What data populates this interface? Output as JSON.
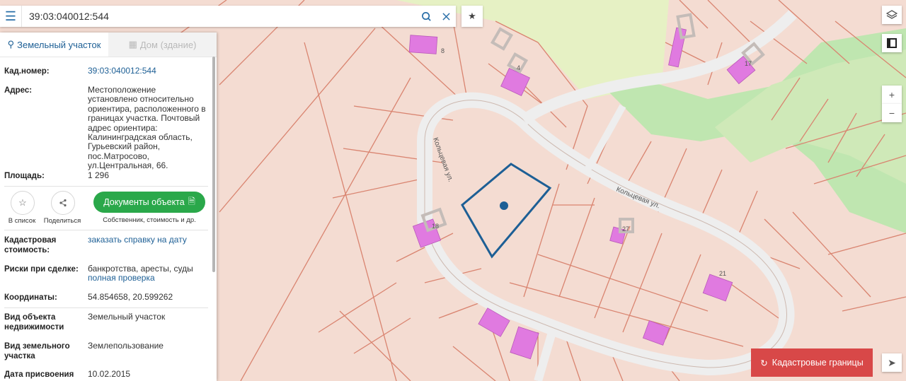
{
  "search": {
    "value": "39:03:040012:544"
  },
  "tabs": [
    {
      "label": "Земельный участок",
      "icon": "land-plot-icon"
    },
    {
      "label": "Дом (здание)",
      "icon": "building-icon"
    }
  ],
  "fields": {
    "kad_label": "Кад.номер:",
    "kad_value": "39:03:040012:544",
    "address_label": "Адрес:",
    "address_value": "Местоположение установлено относительно ориентира, расположенного в границах участка. Почтовый адрес ориентира: Калининградская область, Гурьевский район, пос.Матросово, ул.Центральная, 66.",
    "area_label": "Площадь:",
    "area_value": "1 296",
    "cost_label": "Кадастровая стоимость:",
    "cost_value": "заказать справку на дату",
    "risks_label": "Риски при сделке:",
    "risks_value": "банкротства, аресты, суды",
    "risks_link": "полная проверка",
    "coords_label": "Координаты:",
    "coords_value": "54.854658, 20.599262",
    "type_label": "Вид объекта недвижимости",
    "type_value": "Земельный участок",
    "use_label": "Вид земельного участка",
    "use_value": "Землепользование",
    "date_label": "Дата присвоения",
    "date_value": "10.02.2015"
  },
  "actions": {
    "to_list": "В список",
    "share": "Поделиться",
    "docs_button": "Документы объекта",
    "docs_sub": "Собственник, стоимость и др."
  },
  "map": {
    "street_name": "Кольцевая ул.",
    "house_numbers": [
      "8",
      "4",
      "17",
      "18",
      "27",
      "21"
    ]
  },
  "kadastr_button": "Кадастровые границы",
  "colors": {
    "accent": "#1d5f95",
    "green": "#2aa84a",
    "red": "#d84848",
    "parcel_bg": "#f4dcd2",
    "building": "#e07ae0"
  }
}
